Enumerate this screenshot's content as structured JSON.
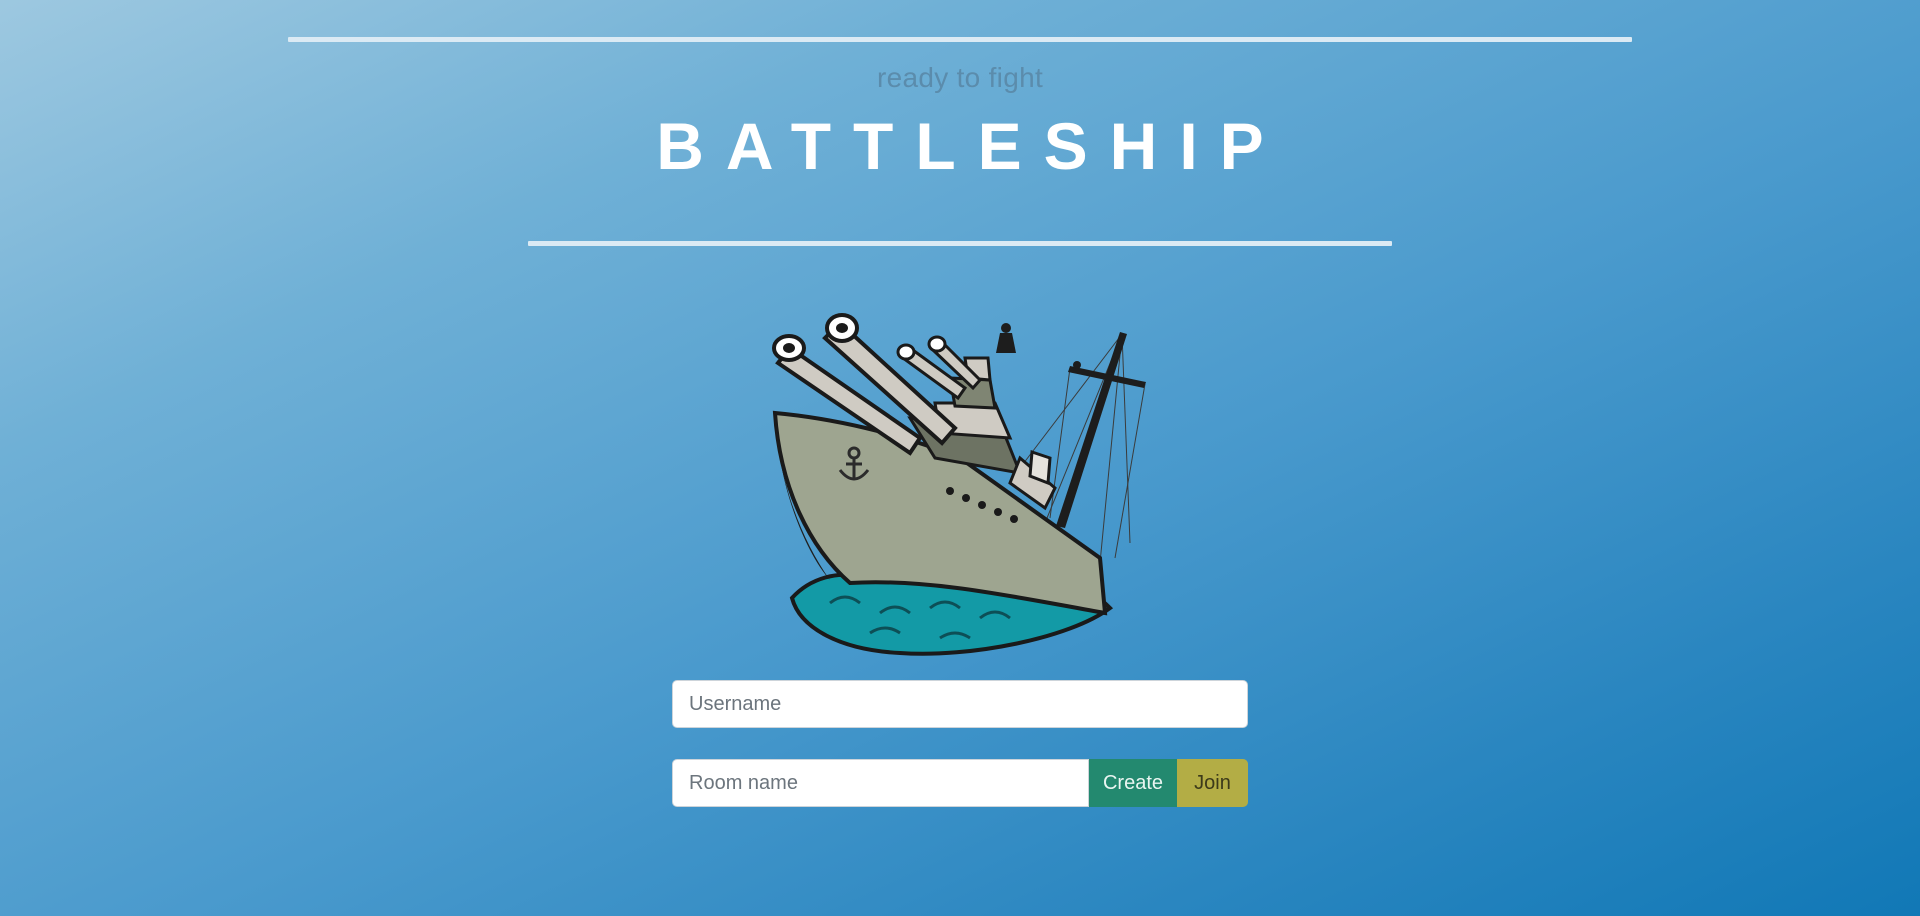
{
  "header": {
    "subtitle": "ready to fight",
    "title": "BATTLESHIP"
  },
  "illustration": {
    "icon": "battleship-illustration"
  },
  "form": {
    "username_placeholder": "Username",
    "username_value": "",
    "room_placeholder": "Room name",
    "room_value": "",
    "create_label": "Create",
    "join_label": "Join"
  },
  "colors": {
    "create_button": "#23896f",
    "join_button": "#b3ad45",
    "title": "#ffffff"
  }
}
